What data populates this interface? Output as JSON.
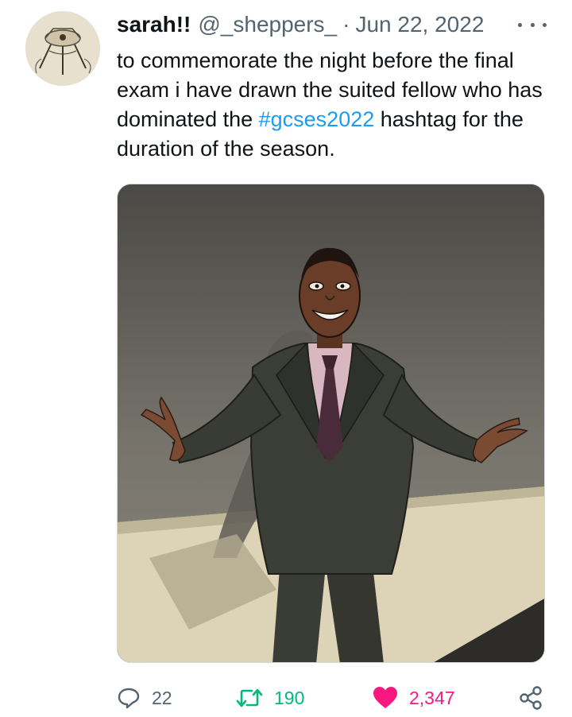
{
  "tweet": {
    "display_name": "sarah!!",
    "handle": "@_sheppers_",
    "separator": "·",
    "date": "Jun 22, 2022",
    "text_before": "to commemorate the night before the final exam i have drawn the suited fellow who has dominated the ",
    "hashtag": "#gcses2022",
    "text_after": " hashtag for the duration of the season."
  },
  "actions": {
    "reply_count": "22",
    "retweet_count": "190",
    "like_count": "2,347"
  },
  "icons": {
    "more": "more-horizontal-icon",
    "reply": "reply-icon",
    "retweet": "retweet-icon",
    "like": "heart-icon",
    "share": "share-icon"
  },
  "colors": {
    "hashtag": "#1d9bf0",
    "retweet_active": "#00ba7c",
    "like_active": "#f91880",
    "secondary_text": "#536471"
  }
}
